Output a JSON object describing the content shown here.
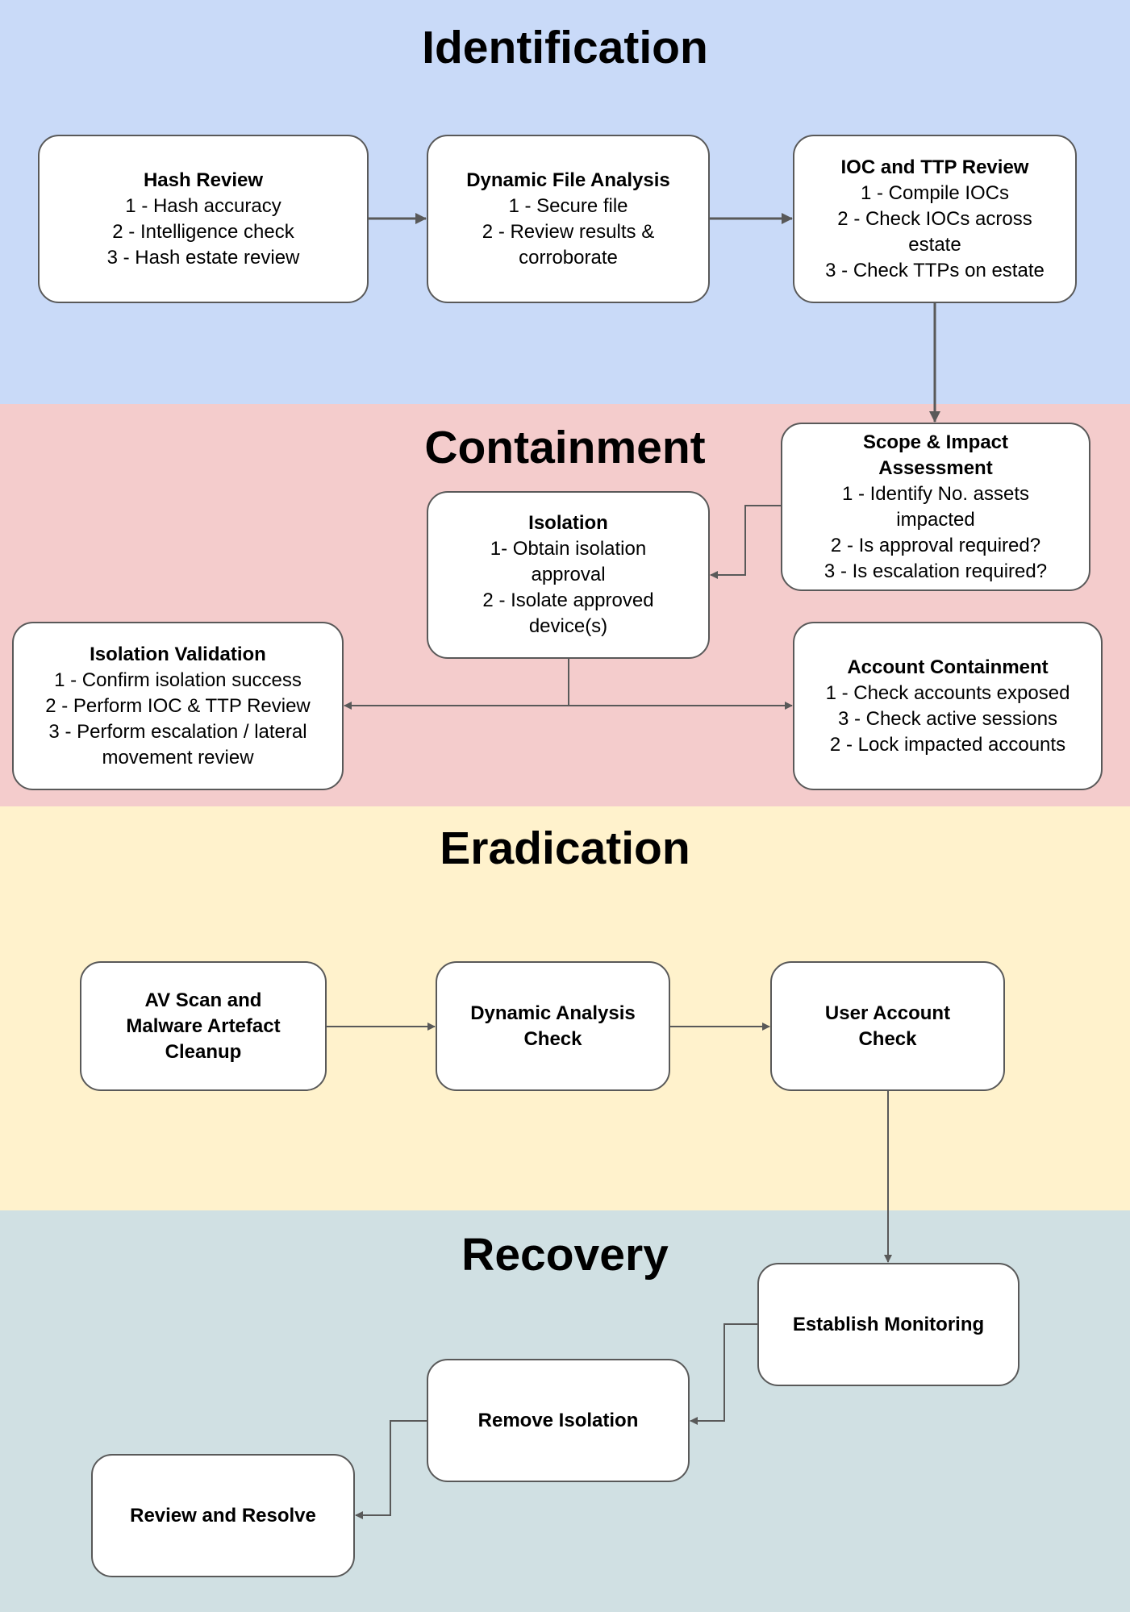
{
  "colors": {
    "identification": "#c9daf8",
    "containment": "#f4cccc",
    "eradication": "#fff2cc",
    "recovery": "#d0e0e3",
    "border": "#595959",
    "connector": "#595959"
  },
  "phases": {
    "identification": {
      "title": "Identification",
      "hash": {
        "title": "Hash Review",
        "lines": [
          "1 - Hash accuracy",
          "2 - Intelligence check",
          "3 - Hash estate review"
        ]
      },
      "dfa": {
        "title": "Dynamic File Analysis",
        "lines": [
          "1 - Secure file",
          "2 - Review results &",
          "corroborate"
        ]
      },
      "ioc": {
        "title": "IOC and TTP Review",
        "lines": [
          "1 - Compile IOCs",
          "2 - Check IOCs across",
          "estate",
          "3 - Check TTPs on estate"
        ]
      }
    },
    "containment": {
      "title": "Containment",
      "scope": {
        "title": "Scope & Impact",
        "title2": "Assessment",
        "lines": [
          "1 - Identify No. assets",
          "impacted",
          "2 - Is approval required?",
          "3 - Is escalation required?"
        ]
      },
      "isolation": {
        "title": "Isolation",
        "lines": [
          "1- Obtain isolation",
          "approval",
          "2 - Isolate approved",
          "device(s)"
        ]
      },
      "validation": {
        "title": "Isolation Validation",
        "lines": [
          "1 - Confirm isolation success",
          "2 - Perform IOC & TTP Review",
          "3 - Perform escalation / lateral",
          "movement review"
        ]
      },
      "account": {
        "title": "Account Containment",
        "lines": [
          "1 - Check accounts exposed",
          "3 - Check active sessions",
          "2 - Lock impacted accounts"
        ]
      }
    },
    "eradication": {
      "title": "Eradication",
      "av": {
        "lines": [
          "AV Scan and",
          "Malware Artefact",
          "Cleanup"
        ]
      },
      "da": {
        "lines": [
          "Dynamic Analysis",
          "Check"
        ]
      },
      "user": {
        "lines": [
          "User Account",
          "Check"
        ]
      }
    },
    "recovery": {
      "title": "Recovery",
      "monitor": {
        "title": "Establish Monitoring"
      },
      "remove": {
        "title": "Remove Isolation"
      },
      "review": {
        "title": "Review and Resolve"
      }
    }
  }
}
